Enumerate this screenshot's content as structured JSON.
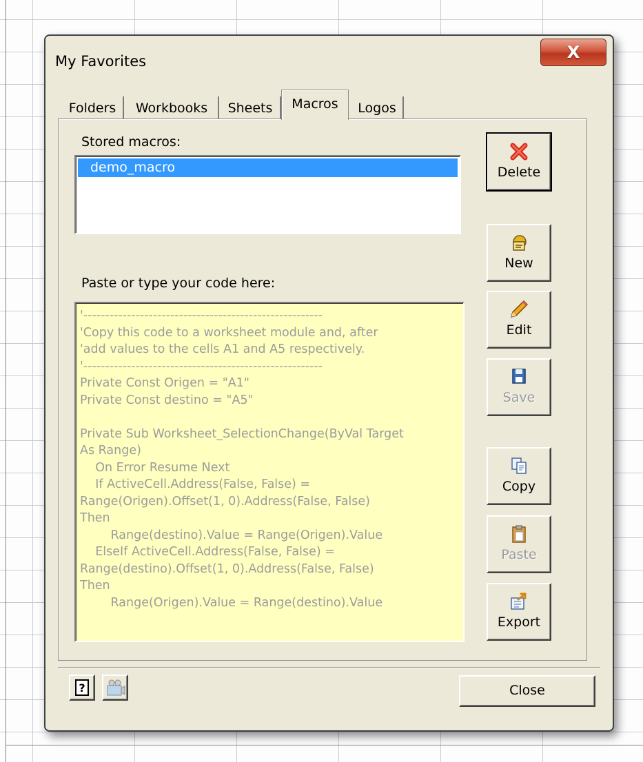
{
  "dialog": {
    "title": "My Favorites",
    "close_glyph": "X"
  },
  "tabs": [
    {
      "label": "Folders",
      "active": false
    },
    {
      "label": "Workbooks",
      "active": false
    },
    {
      "label": "Sheets",
      "active": false
    },
    {
      "label": "Macros",
      "active": true
    },
    {
      "label": "Logos",
      "active": false
    }
  ],
  "macros": {
    "stored_label": "Stored macros:",
    "items": [
      "demo_macro"
    ],
    "selected": "demo_macro",
    "code_label": "Paste or type your code here:",
    "code_lines": [
      "'-------------------------------------------------------",
      "'Copy this code to a worksheet module and, after",
      "'add values to the cells A1 and A5 respectively.",
      "'-------------------------------------------------------",
      "Private Const Origen = \"A1\"",
      "Private Const destino = \"A5\"",
      "",
      "Private Sub Worksheet_SelectionChange(ByVal Target",
      "As Range)",
      "    On Error Resume Next",
      "    If ActiveCell.Address(False, False) =",
      "Range(Origen).Offset(1, 0).Address(False, False)",
      "Then",
      "        Range(destino).Value = Range(Origen).Value",
      "    ElseIf ActiveCell.Address(False, False) =",
      "Range(destino).Offset(1, 0).Address(False, False)",
      "Then",
      "        Range(Origen).Value = Range(destino).Value"
    ]
  },
  "buttons": {
    "delete": {
      "label": "Delete",
      "icon": "red-x-icon",
      "enabled": true
    },
    "new": {
      "label": "New",
      "icon": "new-macro-icon",
      "enabled": true
    },
    "edit": {
      "label": "Edit",
      "icon": "pencil-icon",
      "enabled": true
    },
    "save": {
      "label": "Save",
      "icon": "floppy-disk-icon",
      "enabled": false
    },
    "copy": {
      "label": "Copy",
      "icon": "copy-icon",
      "enabled": true
    },
    "paste": {
      "label": "Paste",
      "icon": "clipboard-icon",
      "enabled": false
    },
    "export": {
      "label": "Export",
      "icon": "export-icon",
      "enabled": true
    }
  },
  "footer": {
    "help_glyph": "?",
    "close_label": "Close"
  },
  "colors": {
    "dialog_bg": "#ece9d8",
    "selection": "#3399ff",
    "code_bg": "#ffffc0",
    "code_text": "#9c9c9c",
    "close_x_red": "#c4442a"
  }
}
